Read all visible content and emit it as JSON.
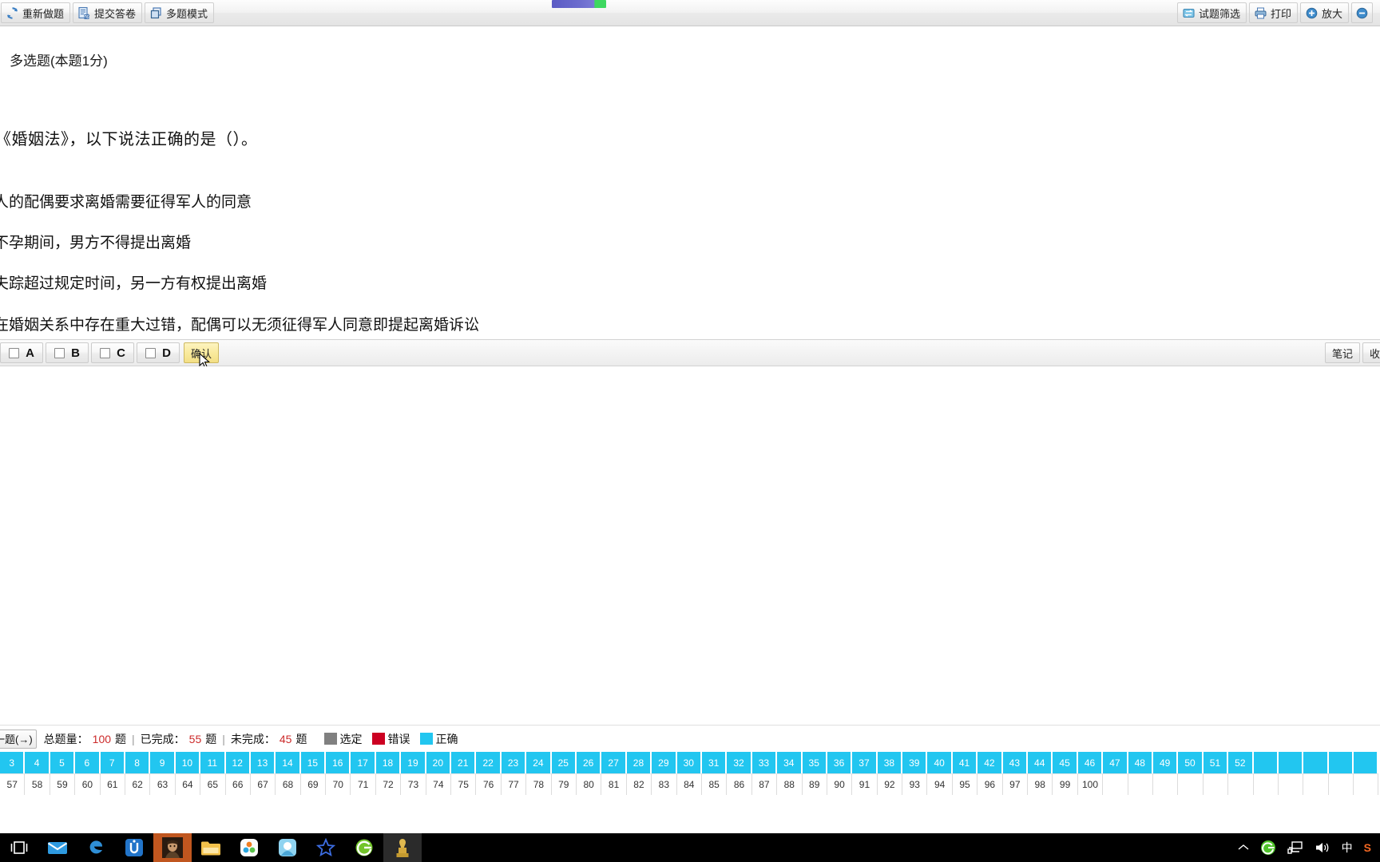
{
  "toolbar": {
    "left_buttons": [
      {
        "label": "重新做题",
        "icon": "refresh-icon"
      },
      {
        "label": "提交答卷",
        "icon": "submit-paper-icon"
      },
      {
        "label": "多题模式",
        "icon": "multi-question-icon"
      }
    ],
    "right_buttons": [
      {
        "label": "试题筛选",
        "icon": "filter-icon"
      },
      {
        "label": "打印",
        "icon": "print-icon"
      },
      {
        "label": "放大",
        "icon": "zoom-in-icon"
      },
      {
        "label": "",
        "icon": "zoom-out-icon"
      }
    ]
  },
  "question": {
    "type_label": "多选题(本题1分)",
    "stem": "《婚姻法》，以下说法正确的是（）。",
    "options": [
      "人的配偶要求离婚需要征得军人的同意",
      "不孕期间，男方不得提出离婚",
      "夫踪超过规定时间，另一方有权提出离婚",
      "在婚姻关系中存在重大过错，配偶可以无须征得军人同意即提起离婚诉讼"
    ]
  },
  "answer_bar": {
    "choices": [
      {
        "letter": "A",
        "checked": false
      },
      {
        "letter": "B",
        "checked": false
      },
      {
        "letter": "C",
        "checked": false
      },
      {
        "letter": "D",
        "checked": false
      }
    ],
    "confirm_label": "确认",
    "note_label": "笔记",
    "favorite_label": "收藏"
  },
  "status": {
    "nav_label": "一题(→)",
    "total_label": "总题量：",
    "total_value": "100",
    "total_unit": "题",
    "done_label": "已完成：",
    "done_value": "55",
    "done_unit": "题",
    "undone_label": "未完成：",
    "undone_value": "45",
    "undone_unit": "题",
    "legend": [
      {
        "name": "选定",
        "color": "#808080"
      },
      {
        "name": "错误",
        "color": "#cc0022"
      },
      {
        "name": "正确",
        "color": "#22c6f0"
      }
    ]
  },
  "grid": {
    "top_row_start": 3,
    "top_row_end": 52,
    "bottom_row_start": 57,
    "bottom_row_end": 100,
    "row_cells": 55,
    "answered_color": "#22c6f0",
    "unanswered_color": "#ffffff"
  },
  "taskbar": {
    "items": [
      {
        "name": "task-view-icon"
      },
      {
        "name": "mail-icon"
      },
      {
        "name": "edge-browser-icon"
      },
      {
        "name": "u-app-icon"
      },
      {
        "name": "game-portrait-icon",
        "active": true
      },
      {
        "name": "file-explorer-icon"
      },
      {
        "name": "cloud-app-icon"
      },
      {
        "name": "blue-app-icon"
      },
      {
        "name": "star-app-icon"
      },
      {
        "name": "green-browser-icon"
      },
      {
        "name": "statue-app-icon",
        "semi": true
      }
    ],
    "tray": [
      {
        "name": "show-hidden-icons-chevron",
        "glyph": "⌃"
      },
      {
        "name": "green-circle-tray-icon",
        "glyph": ""
      },
      {
        "name": "network-icon",
        "glyph": ""
      },
      {
        "name": "volume-icon",
        "glyph": ""
      },
      {
        "name": "ime-mode-label",
        "glyph": "中"
      },
      {
        "name": "sogou-ime-icon",
        "glyph": "S"
      }
    ]
  }
}
